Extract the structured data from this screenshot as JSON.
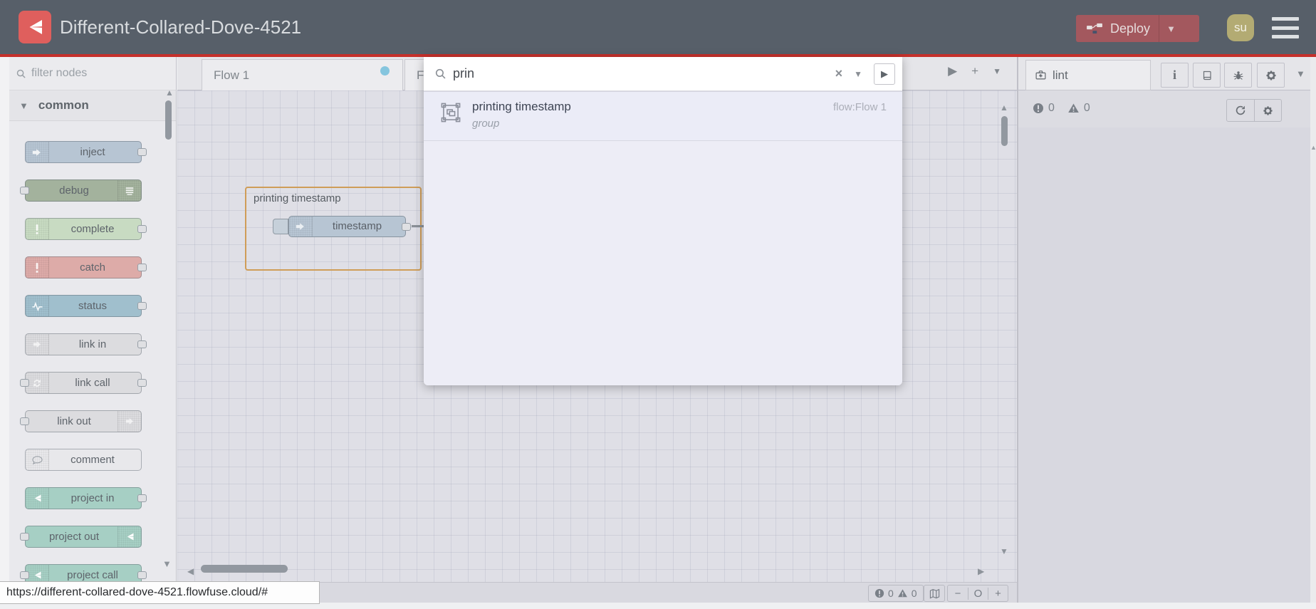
{
  "header": {
    "title": "Different-Collared-Dove-4521",
    "deploy_label": "Deploy",
    "avatar_text": "su"
  },
  "palette": {
    "filter_placeholder": "filter nodes",
    "category_label": "common",
    "nodes": [
      {
        "label": "inject",
        "color": "#b7c5d3",
        "icon": "inject",
        "icon_side": "left",
        "port_left": false,
        "port_right": true
      },
      {
        "label": "debug",
        "color": "#a3b29d",
        "icon": "debug",
        "icon_side": "right",
        "port_left": true,
        "port_right": false
      },
      {
        "label": "complete",
        "color": "#c8dbc2",
        "icon": "exclaim",
        "icon_side": "left",
        "port_left": false,
        "port_right": true
      },
      {
        "label": "catch",
        "color": "#ddaba8",
        "icon": "exclaim",
        "icon_side": "left",
        "port_left": false,
        "port_right": true
      },
      {
        "label": "status",
        "color": "#a0bfcd",
        "icon": "pulse",
        "icon_side": "left",
        "port_left": false,
        "port_right": true
      },
      {
        "label": "link in",
        "color": "#dcdcdf",
        "icon": "link",
        "icon_side": "left",
        "port_left": false,
        "port_right": true
      },
      {
        "label": "link call",
        "color": "#dcdcdf",
        "icon": "linkcall",
        "icon_side": "left",
        "port_left": true,
        "port_right": true
      },
      {
        "label": "link out",
        "color": "#dcdcdf",
        "icon": "link",
        "icon_side": "right",
        "port_left": true,
        "port_right": false
      },
      {
        "label": "comment",
        "color": "#e8e8eb",
        "icon": "comment",
        "icon_side": "left",
        "port_left": false,
        "port_right": false
      },
      {
        "label": "project in",
        "color": "#a6cfc4",
        "icon": "fflogo",
        "icon_side": "left",
        "port_left": false,
        "port_right": true
      },
      {
        "label": "project out",
        "color": "#a6cfc4",
        "icon": "fflogo",
        "icon_side": "right",
        "port_left": true,
        "port_right": false
      },
      {
        "label": "project call",
        "color": "#a6cfc4",
        "icon": "fflogo",
        "icon_side": "left",
        "port_left": true,
        "port_right": true
      }
    ]
  },
  "canvas": {
    "tabs": [
      {
        "label": "Flow 1"
      },
      {
        "label": "Fl"
      }
    ],
    "group": {
      "label": "printing timestamp",
      "node_label": "timestamp"
    }
  },
  "search": {
    "query": "prin",
    "results": [
      {
        "label": "printing timestamp",
        "sublabel": "group",
        "flow": "flow:Flow 1"
      }
    ]
  },
  "sidebar": {
    "tab_label": "lint",
    "error_count": "0",
    "warning_count": "0"
  },
  "canvas_footer": {
    "error_count": "0",
    "warning_count": "0",
    "zoom_out": "−",
    "zoom_reset": "O",
    "zoom_in": "+"
  },
  "status_bar": {
    "url": "https://different-collared-dove-4521.flowfuse.cloud/#"
  },
  "colors": {
    "header_bg": "#575f69",
    "accent_red": "#c5302b",
    "deploy_bg": "#a3585e",
    "logo_red": "#df5f5d",
    "avatar_bg": "#b3ab73",
    "group_border": "#cf9d58",
    "tab_dot": "#85c5de",
    "canvas_bg": "#dfdfe6",
    "results_bg": "#ededf6"
  }
}
